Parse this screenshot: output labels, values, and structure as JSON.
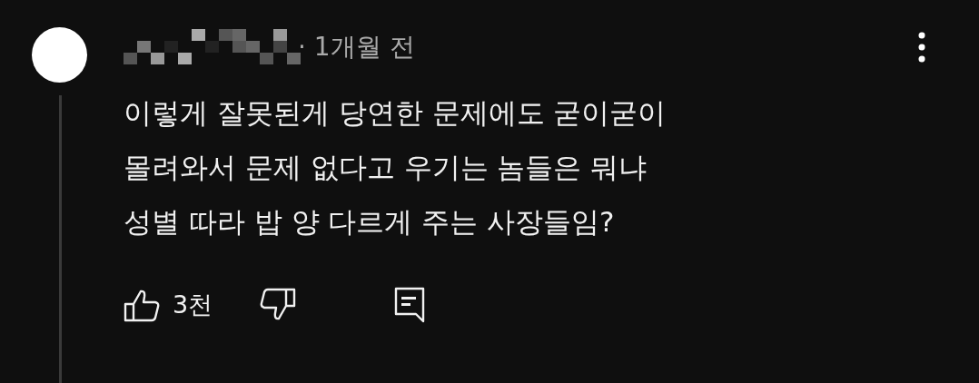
{
  "comment": {
    "time": "· 1개월 전",
    "lines": [
      "이렇게 잘못된게 당연한 문제에도 굳이굳이",
      "몰려와서 문제 없다고 우기는 놈들은 뭐냐",
      "성별 따라 밥 양 다르게 주는 사장들임?"
    ],
    "like_count": "3천"
  }
}
